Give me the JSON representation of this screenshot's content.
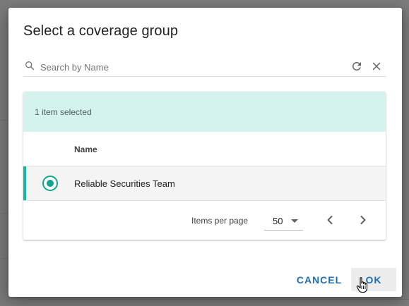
{
  "dialog": {
    "title": "Select a coverage group",
    "search": {
      "placeholder": "Search by Name",
      "value": ""
    },
    "selection_banner": "1 item selected",
    "table": {
      "columns": [
        "Name"
      ],
      "rows": [
        {
          "name": "Reliable Securities Team",
          "selected": true
        }
      ]
    },
    "paginator": {
      "items_per_page_label": "Items per page",
      "items_per_page": "50"
    },
    "actions": {
      "cancel_label": "CANCEL",
      "ok_label": "OK"
    }
  },
  "icons": [
    "search-icon",
    "refresh-icon",
    "close-icon",
    "chevron-left-icon",
    "chevron-right-icon",
    "dropdown-arrow-icon",
    "hand-pointer-icon"
  ],
  "colors": {
    "accent_teal": "#14b8a0",
    "selection_banner_bg": "#d4f3ee",
    "button_text": "#1f6fb2",
    "selected_row_bg": "#f4f4f4"
  }
}
